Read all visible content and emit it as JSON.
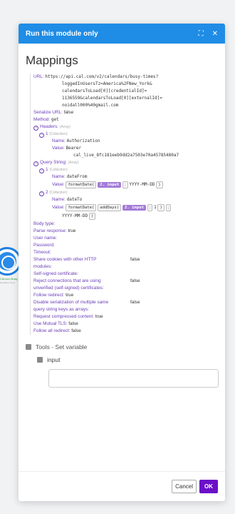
{
  "background": {
    "node_label": "Cal.com Busy Times",
    "node_sub": "Get Busy Times"
  },
  "modal": {
    "title": "Run this module only",
    "heading": "Mappings",
    "url_label": "URL:",
    "url_value": "https://api.cal.com/v2/calendars/busy-times?loggedInUsersTz=America%2FNew_York&calendarsToLoad[0][credentialId]=1136559&calendarsToLoad[0][externalId]=noidall000%40gmail.com",
    "url_lines": [
      "https://api.cal.com/v2/calendars/busy-times?",
      "loggedInUsersTz=America%2FNew_York&",
      "calendarsToLoad[0][credentialId]=",
      "1136559&calendarsToLoad[0][externalId]=",
      "noidall000%40gmail.com"
    ],
    "serialize_url": {
      "label": "Serialize URL:",
      "value": "false"
    },
    "method": {
      "label": "Method:",
      "value": "get"
    },
    "headers": {
      "label": "Headers:",
      "type": "(Array)"
    },
    "header_item": {
      "index": "1",
      "type": "(Collection)",
      "name_label": "Name:",
      "name": "Authorization",
      "value_label": "Value:",
      "value_lines": [
        "Bearer",
        "cal_live_8fc181eeb9dd2a7503e70a45785480a7"
      ]
    },
    "query": {
      "label": "Query String:",
      "type": "(Array)"
    },
    "query_item1": {
      "index": "1",
      "type": "(Collection)",
      "name_label": "Name:",
      "name": "dateFrom",
      "value_label": "Value:",
      "fn": "formatDate(",
      "pill": "2. input",
      "sep": ";",
      "format": "YYYY-MM-DD",
      "close": ")"
    },
    "query_item2": {
      "index": "2",
      "type": "(Collection)",
      "name_label": "Name:",
      "name": "dateTo",
      "value_label": "Value:",
      "fn": "formatDate(",
      "fn2": "addDays(",
      "pill": "2. input",
      "sep": ";",
      "num": "1",
      "close": ")",
      "sep2": ";",
      "format": "YYYY-MM-DD",
      "close2": ")"
    },
    "fields": [
      {
        "label": "Body type:",
        "value": ""
      },
      {
        "label": "Parse response:",
        "value": "true"
      },
      {
        "label": "User name:",
        "value": ""
      },
      {
        "label": "Password:",
        "value": ""
      },
      {
        "label": "Timeout:",
        "value": ""
      }
    ],
    "share_cookies": {
      "label_line1": "Share cookies with other HTTP",
      "label_line2": "modules:",
      "value": "false"
    },
    "self_signed": {
      "label": "Self-signed certificate:"
    },
    "reject": {
      "line1": "Reject connections that are using",
      "line2": "unverified (self-signed) certificates:",
      "value": "false"
    },
    "follow_redirect": {
      "label": "Follow redirect:",
      "value": "true"
    },
    "disable_serial": {
      "line1": "Disable serialization of multiple same",
      "line2": "query string keys as arrays:",
      "value": "false"
    },
    "request_compressed": {
      "label": "Request compressed content:",
      "value": "true"
    },
    "mutual_tls": {
      "label": "Use Mutual TLS:",
      "value": "false"
    },
    "follow_all": {
      "label": "Follow all redirect:",
      "value": "false"
    },
    "tools_label": "Tools - Set variable",
    "input_label": "input",
    "cancel_label": "Cancel",
    "ok_label": "OK"
  }
}
